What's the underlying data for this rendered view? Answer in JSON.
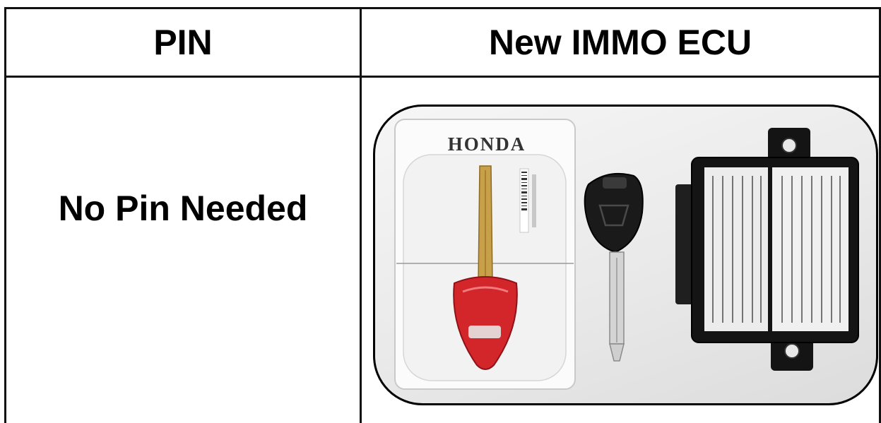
{
  "table": {
    "header_pin": "PIN",
    "header_ecu": "New IMMO ECU",
    "pin_value": "No Pin Needed"
  },
  "photo": {
    "brand_text": "HONDA",
    "items": [
      "key-blister-pack-icon",
      "black-transponder-key-icon",
      "immobilizer-ecu-module-icon"
    ],
    "colors": {
      "red_key": "#d3262b",
      "black_key": "#1a1a1a",
      "module": "#141414"
    }
  }
}
